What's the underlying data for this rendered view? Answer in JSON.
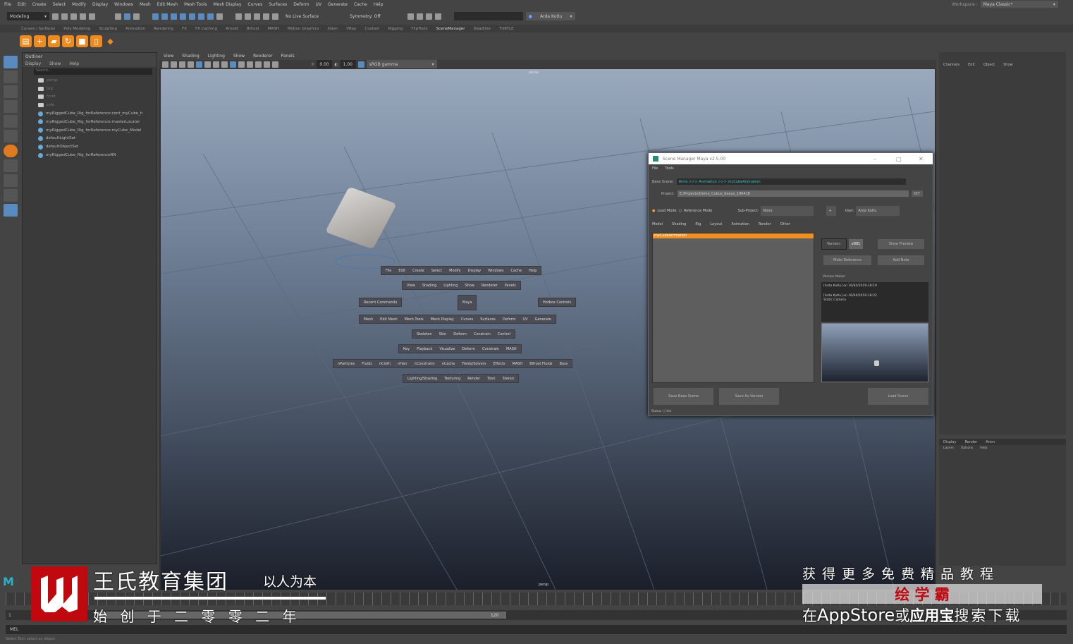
{
  "menubar": [
    "File",
    "Edit",
    "Create",
    "Select",
    "Modify",
    "Display",
    "Windows",
    "Mesh",
    "Edit Mesh",
    "Mesh Tools",
    "Mesh Display",
    "Curves",
    "Surfaces",
    "Deform",
    "UV",
    "Generate",
    "Cache",
    "Help"
  ],
  "toolbar": {
    "mode": "Modeling",
    "live_surface": "No Live Surface",
    "symmetry": "Symmetry: Off",
    "user": "Arda Kutlu",
    "workspace_label": "Workspace :",
    "workspace": "Maya Classic*"
  },
  "shelf_tabs": [
    "Curves / Surfaces",
    "Poly Modeling",
    "Sculpting",
    "Animation",
    "Rendering",
    "FX",
    "FX Caching",
    "Arnold",
    "Bifrost",
    "MASH",
    "Motion Graphics",
    "XGen",
    "VRay",
    "Custom",
    "Rigging",
    "FlipTools",
    "SceneManager",
    "Deadline",
    "TURTLE"
  ],
  "shelf_active": "SceneManager",
  "outliner": {
    "title": "Outliner",
    "menu": [
      "Display",
      "Show",
      "Help"
    ],
    "search_placeholder": "Search...",
    "items": [
      {
        "label": "persp",
        "icon": "camera-icon",
        "dim": true
      },
      {
        "label": "top",
        "icon": "camera-icon",
        "dim": true
      },
      {
        "label": "front",
        "icon": "camera-icon",
        "dim": true
      },
      {
        "label": "side",
        "icon": "camera-icon",
        "dim": true
      },
      {
        "label": "myRiggedCube_Rig_forReference:cont_myCube_h",
        "icon": "constraint-icon"
      },
      {
        "label": "myRiggedCube_Rig_forReference:masterLocator",
        "icon": "locator-icon"
      },
      {
        "label": "myRiggedCube_Rig_forReference:myCube_Model",
        "icon": "group-icon"
      },
      {
        "label": "defaultLightSet",
        "icon": "set-icon"
      },
      {
        "label": "defaultObjectSet",
        "icon": "set-icon"
      },
      {
        "label": "myRiggedCube_Rig_forReferenceRN",
        "icon": "reference-icon"
      }
    ]
  },
  "viewport": {
    "menu": [
      "View",
      "Shading",
      "Lighting",
      "Show",
      "Renderer",
      "Panels"
    ],
    "near": "0.00",
    "far": "1.00",
    "color_space": "sRGB gamma",
    "camera_label": "persp",
    "bottom_label": "persp"
  },
  "hotbox": {
    "row1": [
      "File",
      "Edit",
      "Create",
      "Select",
      "Modify",
      "Display",
      "Windows",
      "Cache",
      "Help"
    ],
    "row2": [
      "View",
      "Shading",
      "Lighting",
      "Show",
      "Renderer",
      "Panels"
    ],
    "recent": "Recent Commands",
    "center": "Maya",
    "hotbox_controls": "Hotbox Controls",
    "row3": [
      "Mesh",
      "Edit Mesh",
      "Mesh Tools",
      "Mesh Display",
      "Curves",
      "Surfaces",
      "Deform",
      "UV",
      "Generate"
    ],
    "row4": [
      "Skeleton",
      "Skin",
      "Deform",
      "Constrain",
      "Control"
    ],
    "row5": [
      "Key",
      "Playback",
      "Visualize",
      "Deform",
      "Constrain",
      "MASH"
    ],
    "row6": [
      "nParticles",
      "Fluids",
      "nCloth",
      "nHair",
      "nConstraint",
      "nCache",
      "Fields/Solvers",
      "Effects",
      "MASH",
      "Bifrost Fluids",
      "Boss"
    ],
    "row7": [
      "Lighting/Shading",
      "Texturing",
      "Render",
      "Toon",
      "Stereo"
    ]
  },
  "scene_manager": {
    "title": "Scene Manager Maya v2.5.00",
    "menu": [
      "File",
      "Tools"
    ],
    "base_scene_label": "Base Scene:",
    "base_scene": "Rime >>> Animation >>> myCubeAnimation",
    "project_label": "Project:",
    "project": "E:/Projects/Demo_Cubus_deaus_190418",
    "set_label": "SET",
    "load_mode": "Load Mode",
    "reference_mode": "Reference Mode",
    "subproject_label": "Sub-Project:",
    "subproject": "None",
    "add_label": "+",
    "user_label": "User:",
    "user": "Arda Kutlu",
    "tabs": [
      "Model",
      "Shading",
      "Rig",
      "Layout",
      "Animation",
      "Render",
      "Other"
    ],
    "scenes": [
      "myCubeAnimation"
    ],
    "version_label": "Version:",
    "version": "v001",
    "show_preview": "Show Preview",
    "make_reference": "Make Reference",
    "add_note": "Add Note",
    "notes_label": "Version Notes:",
    "notes": [
      "[Arda Kutlu] on 16/04/2019-18:19",
      "[Arda Kutlu] on 16/04/2019-18:22",
      "Static Camera"
    ],
    "save_base": "Save Base Scene",
    "save_version": "Save As Version",
    "load_scene": "Load Scene",
    "status": "Status: | idle"
  },
  "channel_box": {
    "menu": [
      "Channels",
      "Edit",
      "Object",
      "Show"
    ]
  },
  "layer_editor": {
    "tabs": [
      "Display",
      "Render",
      "Anim"
    ],
    "menu": [
      "Layers",
      "Options",
      "Help"
    ]
  },
  "range": {
    "start": "1",
    "end": "120"
  },
  "cmd_label": "MEL",
  "help_line": "Select Tool: select an object",
  "watermark": {
    "company": "王氏教育集团",
    "slogan": "以人为本",
    "founded": "始 创 于 二 零 零 二 年",
    "promo": "获得更多免费精品教程",
    "app": "绘 学 霸",
    "download_pre": "在",
    "download_app": "AppStore",
    "download_mid": "或",
    "download_store": "应用宝",
    "download_post": "搜索下载",
    "brand_color": "#c0080f"
  }
}
